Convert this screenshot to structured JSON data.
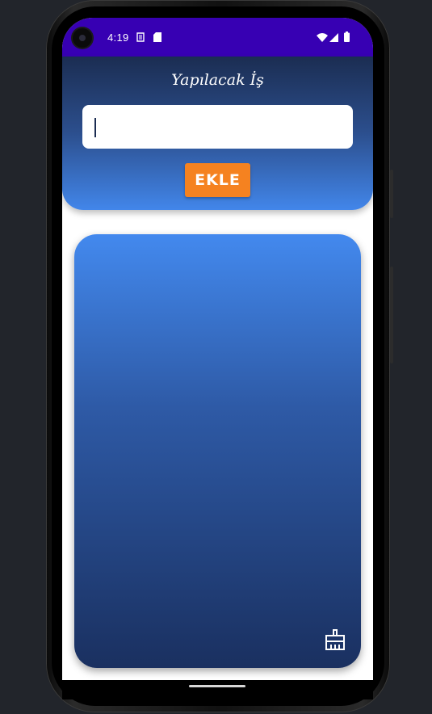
{
  "status_bar": {
    "time": "4:19",
    "left_icons": [
      "sim-icon",
      "sd-card-icon"
    ],
    "right_icons": [
      "wifi-icon",
      "cellular-icon",
      "battery-icon"
    ],
    "color": "#3700b3"
  },
  "header": {
    "title": "Yapılacak İş",
    "input_value": "",
    "input_placeholder": "",
    "add_button_label": "EKLE",
    "gradient_top": "#1b2d52",
    "gradient_bottom": "#4286ea"
  },
  "card": {
    "items": [],
    "clear_icon": "broom-icon",
    "gradient_top": "#4389ee",
    "gradient_bottom": "#1a3060"
  },
  "colors": {
    "accent": "#f58220",
    "background": "#ffffff"
  }
}
